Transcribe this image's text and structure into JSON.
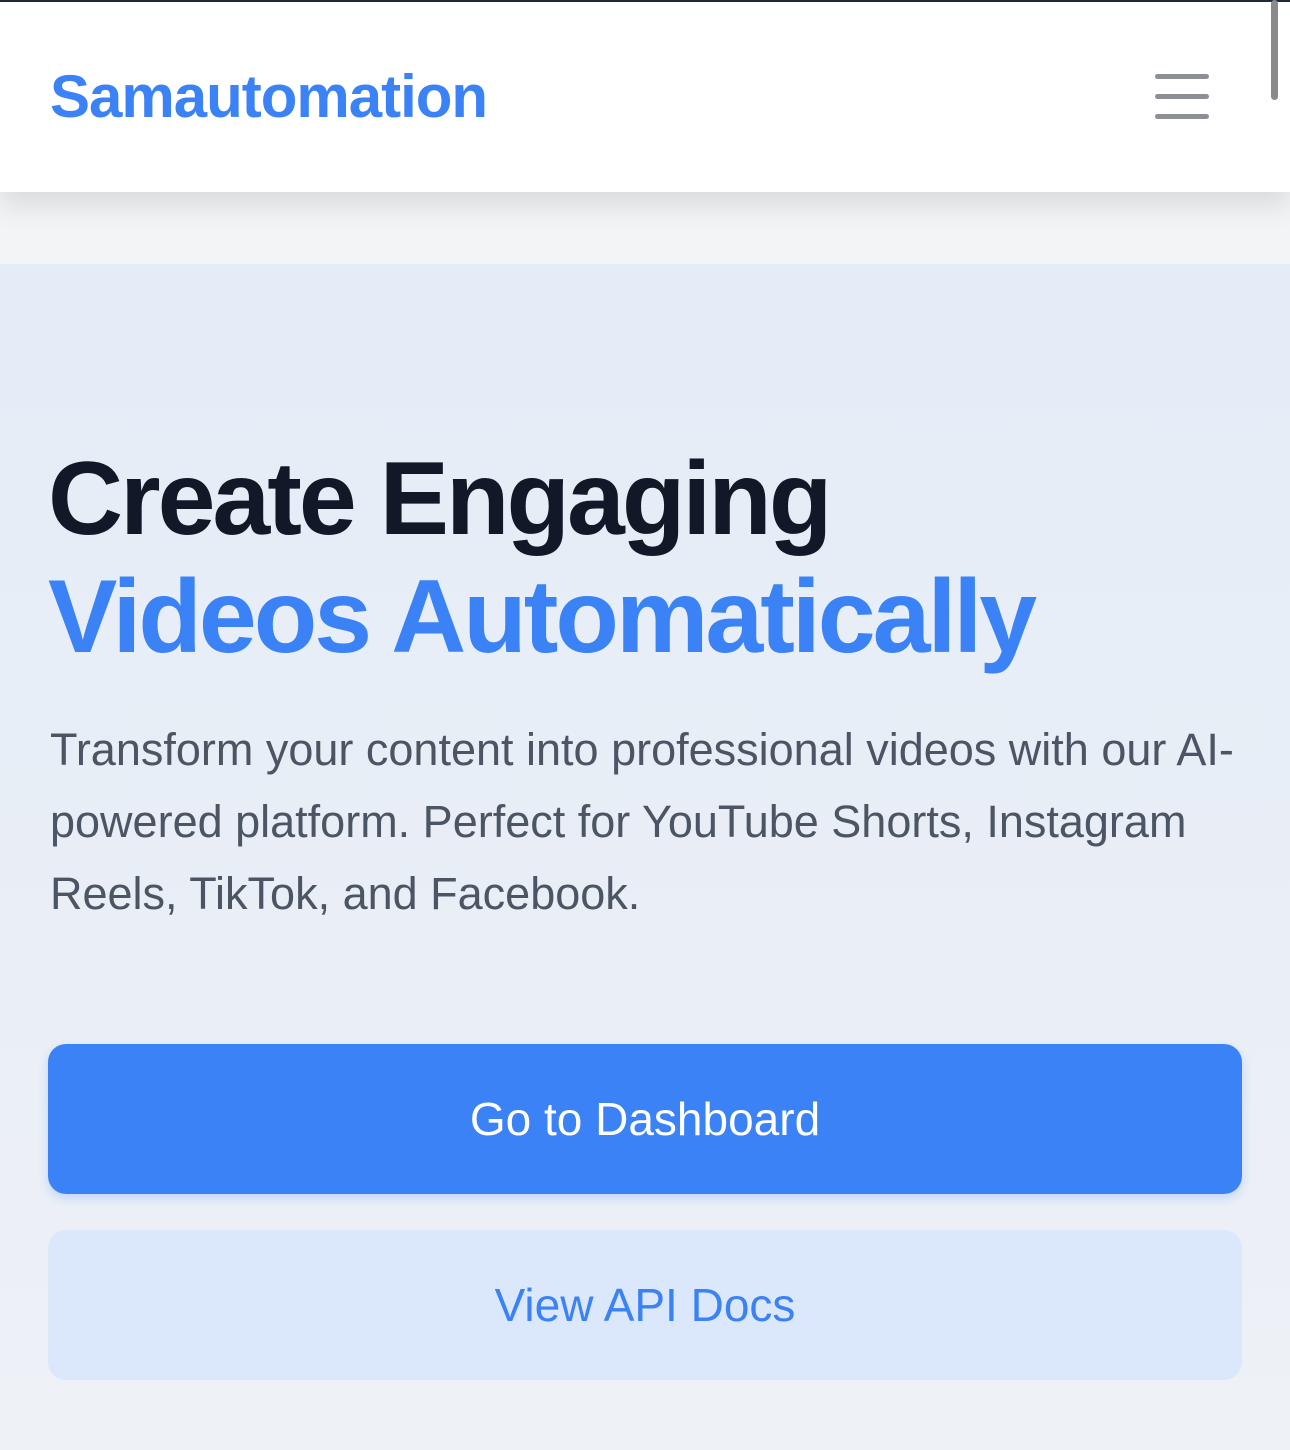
{
  "colors": {
    "brand": "#3b82f6",
    "title_dark": "#111827",
    "body_text": "#4b5563",
    "primary_button_bg": "#3b82f6",
    "primary_button_text": "#ffffff",
    "secondary_button_bg": "#dbe8fb",
    "secondary_button_text": "#3b82f6"
  },
  "header": {
    "brand": "Samautomation",
    "menu_icon": "hamburger-menu-icon"
  },
  "hero": {
    "title_line1": "Create Engaging",
    "title_line2": "Videos Automatically",
    "description": "Transform your content into professional videos with our AI-powered platform. Perfect for YouTube Shorts, Instagram Reels, TikTok, and Facebook.",
    "primary_button": "Go to Dashboard",
    "secondary_button": "View API Docs"
  }
}
